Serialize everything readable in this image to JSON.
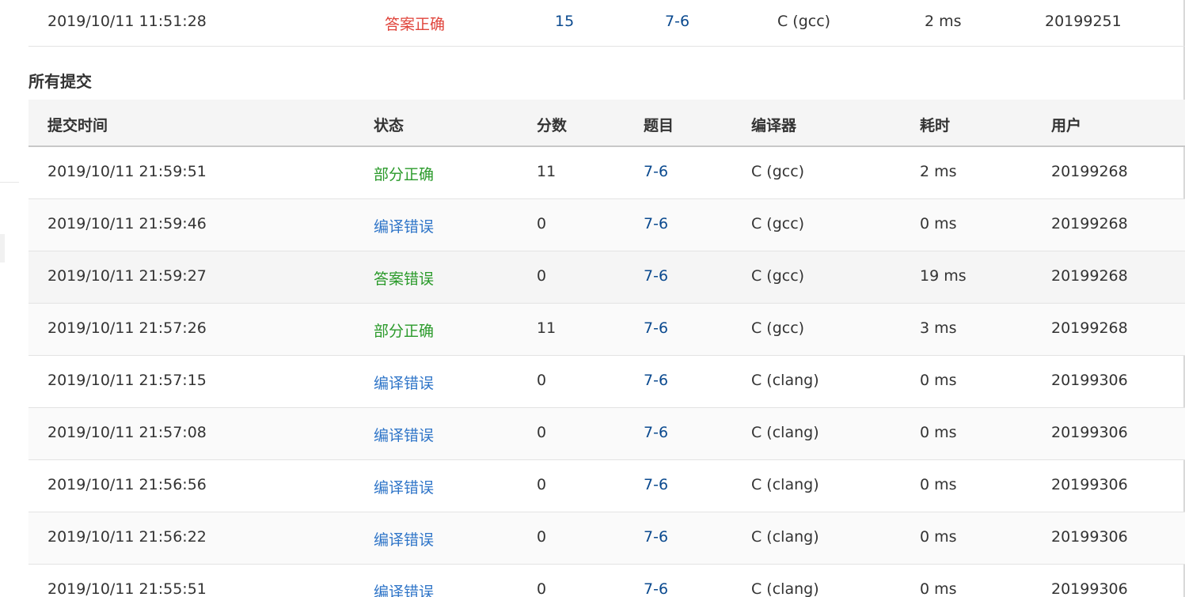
{
  "colors": {
    "status_partial": "#2a9a2a",
    "status_compile_error": "#2f75c8",
    "status_wrong_answer": "#2a9a2a",
    "status_accepted": "#e0453c",
    "link": "#0b4a8f",
    "header_bg": "#f5f5f5",
    "row_alt_bg": "#f5f5f5"
  },
  "top_submission": {
    "time": "2019/10/11 11:51:28",
    "status": "答案正确",
    "status_kind": "accepted",
    "score": "15",
    "problem": "7-6",
    "compiler": "C (gcc)",
    "cost": "2 ms",
    "user": "20199251"
  },
  "section": {
    "title": "所有提交"
  },
  "table": {
    "headers": {
      "time": "提交时间",
      "status": "状态",
      "score": "分数",
      "problem": "题目",
      "compiler": "编译器",
      "cost": "耗时",
      "user": "用户"
    },
    "rows": [
      {
        "time": "2019/10/11 21:59:51",
        "status": "部分正确",
        "status_kind": "partial",
        "score": "11",
        "problem": "7-6",
        "compiler": "C (gcc)",
        "cost": "2 ms",
        "user": "20199268"
      },
      {
        "time": "2019/10/11 21:59:46",
        "status": "编译错误",
        "status_kind": "compile_error",
        "score": "0",
        "problem": "7-6",
        "compiler": "C (gcc)",
        "cost": "0 ms",
        "user": "20199268"
      },
      {
        "time": "2019/10/11 21:59:27",
        "status": "答案错误",
        "status_kind": "wrong_answer",
        "score": "0",
        "problem": "7-6",
        "compiler": "C (gcc)",
        "cost": "19 ms",
        "user": "20199268"
      },
      {
        "time": "2019/10/11 21:57:26",
        "status": "部分正确",
        "status_kind": "partial",
        "score": "11",
        "problem": "7-6",
        "compiler": "C (gcc)",
        "cost": "3 ms",
        "user": "20199268"
      },
      {
        "time": "2019/10/11 21:57:15",
        "status": "编译错误",
        "status_kind": "compile_error",
        "score": "0",
        "problem": "7-6",
        "compiler": "C (clang)",
        "cost": "0 ms",
        "user": "20199306"
      },
      {
        "time": "2019/10/11 21:57:08",
        "status": "编译错误",
        "status_kind": "compile_error",
        "score": "0",
        "problem": "7-6",
        "compiler": "C (clang)",
        "cost": "0 ms",
        "user": "20199306"
      },
      {
        "time": "2019/10/11 21:56:56",
        "status": "编译错误",
        "status_kind": "compile_error",
        "score": "0",
        "problem": "7-6",
        "compiler": "C (clang)",
        "cost": "0 ms",
        "user": "20199306"
      },
      {
        "time": "2019/10/11 21:56:22",
        "status": "编译错误",
        "status_kind": "compile_error",
        "score": "0",
        "problem": "7-6",
        "compiler": "C (clang)",
        "cost": "0 ms",
        "user": "20199306"
      },
      {
        "time": "2019/10/11 21:55:51",
        "status": "编译错误",
        "status_kind": "compile_error",
        "score": "0",
        "problem": "7-6",
        "compiler": "C (clang)",
        "cost": "0 ms",
        "user": "20199306"
      }
    ]
  }
}
